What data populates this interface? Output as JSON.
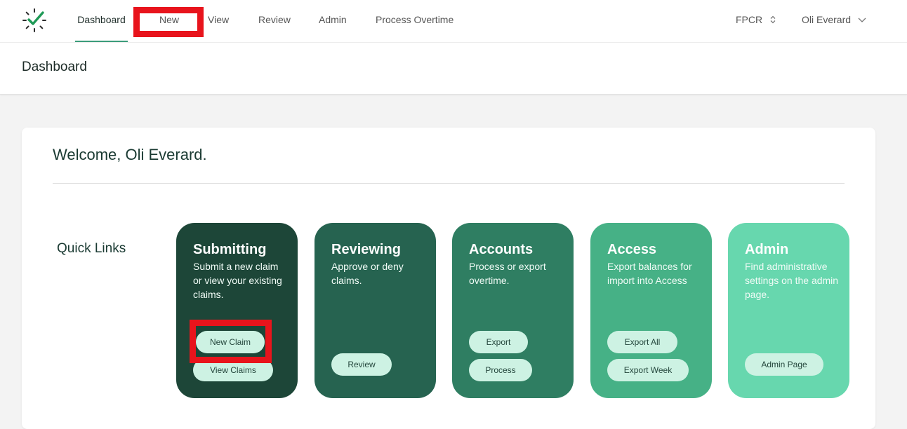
{
  "nav": {
    "items": [
      {
        "label": "Dashboard"
      },
      {
        "label": "New"
      },
      {
        "label": "View"
      },
      {
        "label": "Review"
      },
      {
        "label": "Admin"
      },
      {
        "label": "Process Overtime"
      }
    ],
    "org_selector": "FPCR",
    "user_menu": "Oli Everard"
  },
  "page": {
    "title": "Dashboard"
  },
  "welcome": "Welcome, Oli Everard.",
  "quick_links": {
    "label": "Quick Links",
    "tiles": [
      {
        "title": "Submitting",
        "desc": "Submit a new claim or view your existing claims.",
        "color": "#1d4638",
        "buttons": [
          "New Claim",
          "View Claims"
        ]
      },
      {
        "title": "Reviewing",
        "desc": "Approve or deny claims.",
        "color": "#266350",
        "buttons": [
          "Review"
        ]
      },
      {
        "title": "Accounts",
        "desc": "Process or export overtime.",
        "color": "#2f7e62",
        "buttons": [
          "Export",
          "Process"
        ]
      },
      {
        "title": "Access",
        "desc": "Export balances for import into Access",
        "color": "#46b186",
        "buttons": [
          "Export All",
          "Export Week"
        ]
      },
      {
        "title": "Admin",
        "desc": "Find administrative settings on the admin page.",
        "color": "#67d7ae",
        "buttons": [
          "Admin Page"
        ]
      }
    ]
  },
  "colors": {
    "accent": "#3b9c7a",
    "highlight": "#e8141c",
    "button_bg": "#cdf2e3"
  },
  "icons": {
    "logo": "clock-check-icon",
    "org_toggle": "chevron-updown-icon",
    "user_toggle": "chevron-down-icon"
  }
}
